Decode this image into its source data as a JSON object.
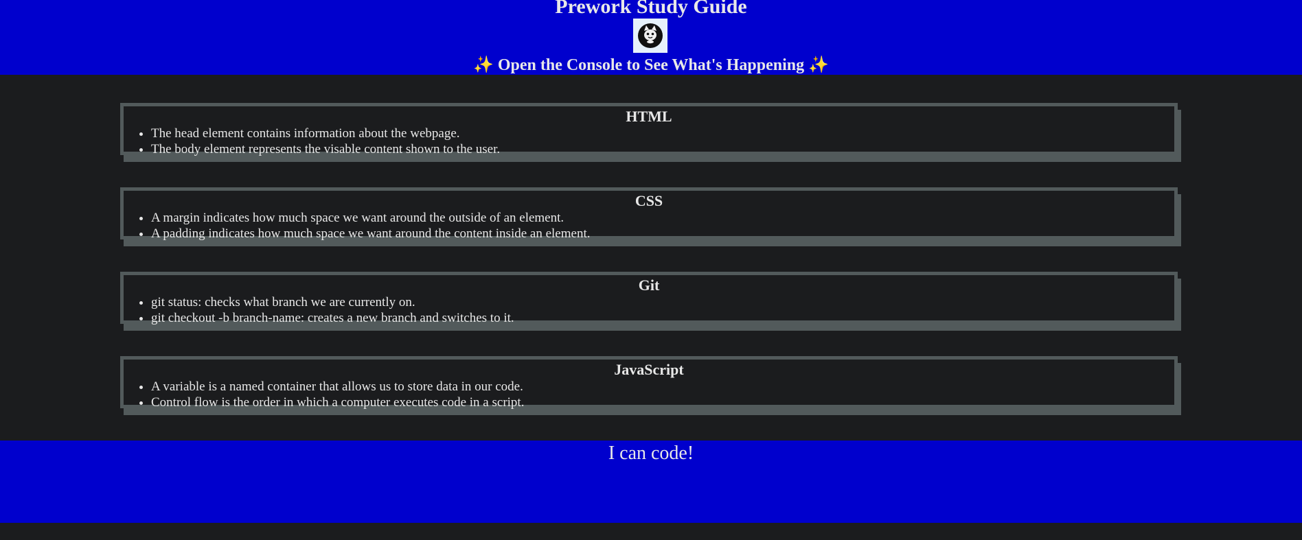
{
  "header": {
    "title": "Prework Study Guide",
    "logo_icon": "cat-face-icon",
    "subtitle_spark": "✨",
    "subtitle": "Open the Console to See What's Happening"
  },
  "sections": [
    {
      "title": "HTML",
      "items": [
        "The head element contains information about the webpage.",
        "The body element represents the visable content shown to the user."
      ]
    },
    {
      "title": "CSS",
      "items": [
        "A margin indicates how much space we want around the outside of an element.",
        "A padding indicates how much space we want around the content inside an element."
      ]
    },
    {
      "title": "Git",
      "items": [
        "git status: checks what branch we are currently on.",
        "git checkout -b branch-name: creates a new branch and switches to it."
      ]
    },
    {
      "title": "JavaScript",
      "items": [
        "A variable is a named container that allows us to store data in our code.",
        "Control flow is the order in which a computer executes code in a script."
      ]
    }
  ],
  "footer": {
    "text": "I can code!"
  },
  "colors": {
    "banner": "#0000cd",
    "background": "#1b1c1e",
    "card_border": "#525a5b"
  }
}
